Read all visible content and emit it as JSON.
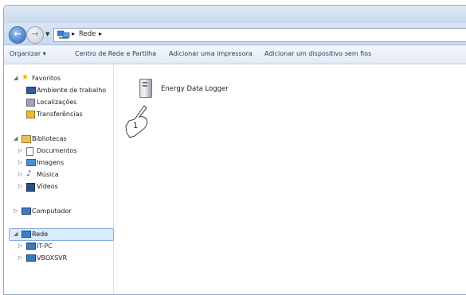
{
  "address": {
    "path": [
      "Rede"
    ]
  },
  "toolbar": {
    "organize": "Organizar",
    "network_center": "Centro de Rede e Partilha",
    "add_printer": "Adicionar uma impressora",
    "add_wireless": "Adicionar um dispositivo sem fios"
  },
  "nav": {
    "favorites": "Favoritos",
    "desktop": "Ambiente de trabalho",
    "places": "Localizações",
    "downloads": "Transferências",
    "libraries": "Bibliotecas",
    "documents": "Documentos",
    "images": "Imagens",
    "music": "Música",
    "videos": "Vídeos",
    "computer": "Computador",
    "network": "Rede",
    "itpc": "IT-PC",
    "vboxsvr": "VBOXSVR"
  },
  "content": {
    "device_name": "Energy Data Logger",
    "callout_number": "1"
  }
}
